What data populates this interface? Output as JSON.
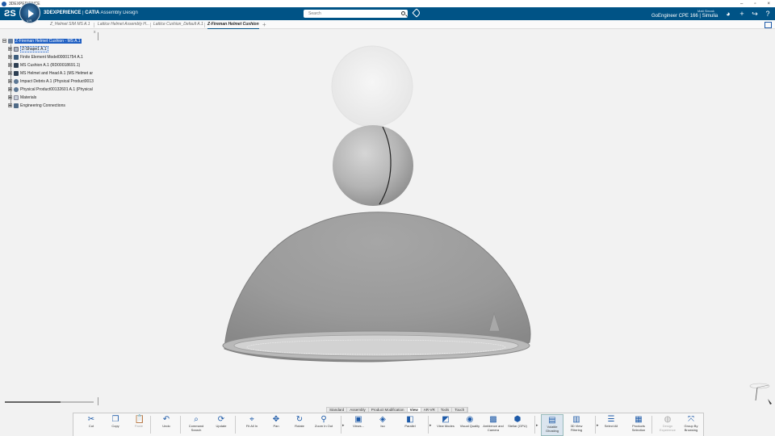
{
  "os": {
    "title": "3DEXPERIENCE",
    "controls": [
      "–",
      "▫",
      "×"
    ]
  },
  "header": {
    "brand": "3DEXPERIENCE",
    "separator": " | ",
    "product": "CATIA",
    "app": "Assembly Design",
    "compass_version": "V.R",
    "search_placeholder": "Search",
    "user_name": "Matt Slezak",
    "tenant": "GoEngineer CPE 166 | Simulia",
    "accent_color": "#005386"
  },
  "tabs": [
    {
      "label": "Z_Helmet SIM MS A.1"
    },
    {
      "label": "Lattice Helmet Assembly H..."
    },
    {
      "label": "Lattice Cushion_Default A.1"
    },
    {
      "label": "Z-Fireman Helmet Cushion"
    }
  ],
  "tree": {
    "root": "Z-Fireman Helmet Cushion - MS A.1",
    "items": [
      {
        "label": "Z-Shape1 A.1",
        "icon": "part-icon"
      },
      {
        "label": "Finite Element Model00001754 A.1",
        "icon": "fem-icon"
      },
      {
        "label": "MS Cushion A.1 (RD00018691.1)",
        "icon": "product-icon"
      },
      {
        "label": "MS Helmet and Head A.1 (MS Helmet ar",
        "icon": "product-icon"
      },
      {
        "label": "Impact Debris A.1 (Physical Product0013",
        "icon": "physical-icon"
      },
      {
        "label": "Physical Product00132601 A.1 (Physical",
        "icon": "physical-icon"
      },
      {
        "label": "Materials",
        "icon": "materials-icon"
      },
      {
        "label": "Engineering Connections",
        "icon": "connections-icon"
      }
    ],
    "close_label": "x"
  },
  "slider": {
    "fill_fraction": 0.63
  },
  "section_tabs": [
    "Standard",
    "Assembly",
    "Product Modification",
    "View",
    "AR-VR",
    "Tools",
    "Touch"
  ],
  "active_section": "View",
  "actions": [
    {
      "label": "Cut",
      "icon": "cut-icon",
      "glyph": "✂"
    },
    {
      "label": "Copy",
      "icon": "copy-icon",
      "glyph": "❐"
    },
    {
      "label": "Paste",
      "icon": "paste-icon",
      "glyph": "📋"
    },
    {
      "label": "Undo",
      "icon": "undo-icon",
      "glyph": "↶"
    },
    {
      "label": "Command Search",
      "icon": "command-search-icon",
      "glyph": "⌕"
    },
    {
      "label": "Update",
      "icon": "update-icon",
      "glyph": "⟳"
    },
    {
      "label": "Fit All In",
      "icon": "fit-all-icon",
      "glyph": "⌖"
    },
    {
      "label": "Pan",
      "icon": "pan-icon",
      "glyph": "✥"
    },
    {
      "label": "Rotate",
      "icon": "rotate-icon",
      "glyph": "↻"
    },
    {
      "label": "Zoom In Out",
      "icon": "zoom-icon",
      "glyph": "⚲"
    },
    {
      "label": "Views...",
      "icon": "views-icon",
      "glyph": "▣"
    },
    {
      "label": "Iso",
      "icon": "iso-icon",
      "glyph": "◈"
    },
    {
      "label": "Parallel",
      "icon": "parallel-icon",
      "glyph": "◧"
    },
    {
      "label": "View Modes",
      "icon": "view-modes-icon",
      "glyph": "◩"
    },
    {
      "label": "Visual Quality",
      "icon": "visual-quality-icon",
      "glyph": "◉"
    },
    {
      "label": "Ambience and Camera",
      "icon": "ambience-icon",
      "glyph": "▩"
    },
    {
      "label": "Stellar (GPU)",
      "icon": "stellar-icon",
      "glyph": "⬢"
    },
    {
      "label": "Volatile Ghosting",
      "icon": "ghosting-icon",
      "glyph": "▤"
    },
    {
      "label": "3D View Filtering",
      "icon": "filtering-icon",
      "glyph": "▥"
    },
    {
      "label": "Select All",
      "icon": "select-all-icon",
      "glyph": "☰"
    },
    {
      "label": "Products Selection",
      "icon": "products-selection-icon",
      "glyph": "▦"
    },
    {
      "label": "Design Experience",
      "icon": "design-experience-icon",
      "glyph": "◍"
    },
    {
      "label": "Group By Browsing",
      "icon": "group-browsing-icon",
      "glyph": "⤧"
    }
  ]
}
